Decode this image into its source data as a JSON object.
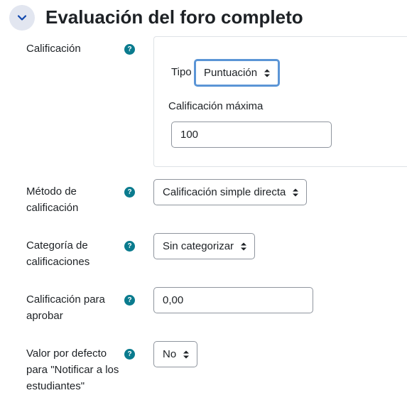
{
  "section": {
    "title": "Evaluación del foro completo"
  },
  "grade": {
    "label": "Calificación",
    "type_label": "Tipo",
    "type_value": "Puntuación",
    "max_label": "Calificación máxima",
    "max_value": "100"
  },
  "method": {
    "label": "Método de calificación",
    "value": "Calificación simple directa"
  },
  "category": {
    "label": "Categoría de calificaciones",
    "value": "Sin categorizar"
  },
  "pass": {
    "label": "Calificación para aprobar",
    "value": "0,00"
  },
  "notify": {
    "label": "Valor por defecto para \"Notificar a los estudiantes\"",
    "value": "No"
  },
  "help": {
    "glyph": "?"
  },
  "colors": {
    "help_icon": "#0a7b8e",
    "focus_ring": "#5b95d6",
    "collapse_bg": "#e2e6f0"
  }
}
